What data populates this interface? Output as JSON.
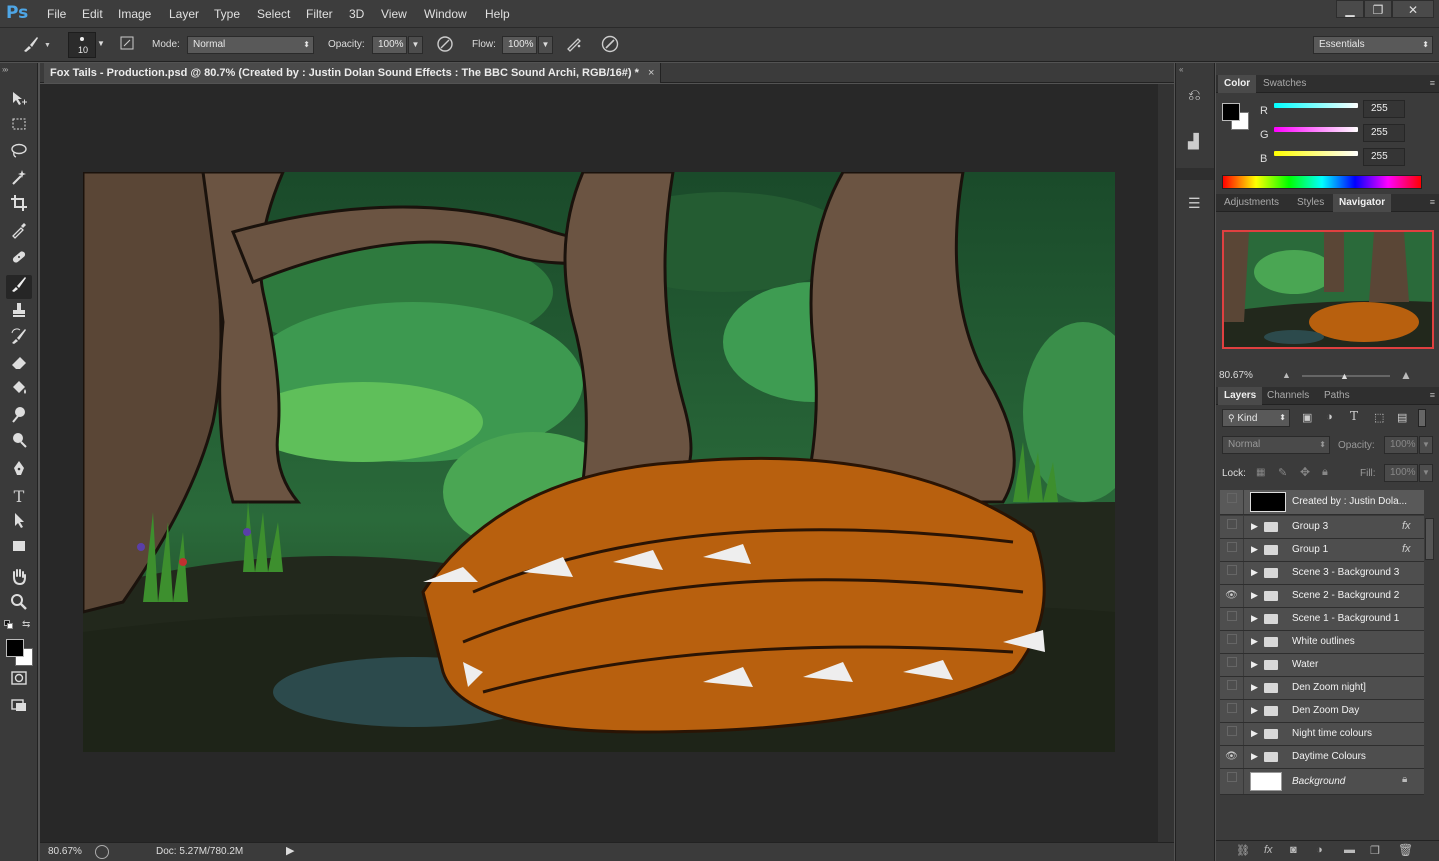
{
  "app": {
    "logo": "Ps"
  },
  "menu": [
    "File",
    "Edit",
    "Image",
    "Layer",
    "Type",
    "Select",
    "Filter",
    "3D",
    "View",
    "Window",
    "Help"
  ],
  "window_controls": {
    "minimize": "▁",
    "restore": "❐",
    "close": "✕"
  },
  "options": {
    "brush_size": "10",
    "mode_label": "Mode:",
    "mode_value": "Normal",
    "opacity_label": "Opacity:",
    "opacity_value": "100%",
    "flow_label": "Flow:",
    "flow_value": "100%",
    "workspace": "Essentials"
  },
  "document": {
    "tab_title": "Fox Tails - Production.psd @ 80.7% (Created by : Justin Dolan   Sound Effects : The BBC Sound Archi, RGB/16#) *",
    "tab_close": "×",
    "zoom": "80.67%",
    "doc_info": "Doc: 5.27M/780.2M"
  },
  "color_panel": {
    "tabs": [
      "Color",
      "Swatches"
    ],
    "channels": [
      {
        "label": "R",
        "value": "255",
        "color": "#00ffff"
      },
      {
        "label": "G",
        "value": "255",
        "color": "#ff00ff"
      },
      {
        "label": "B",
        "value": "255",
        "color": "#ffff00"
      }
    ]
  },
  "nav_panel": {
    "tabs": [
      "Adjustments",
      "Styles",
      "Navigator"
    ],
    "active_tab": "Navigator",
    "zoom": "80.67%"
  },
  "layers_panel": {
    "tabs": [
      "Layers",
      "Channels",
      "Paths"
    ],
    "filter_label": "Kind",
    "blend_mode": "Normal",
    "opacity_label": "Opacity:",
    "opacity_value": "100%",
    "lock_label": "Lock:",
    "fill_label": "Fill:",
    "fill_value": "100%",
    "layers": [
      {
        "name": "Created by : Justin Dola...",
        "type": "text-thumb",
        "visible": false,
        "fx": false
      },
      {
        "name": "Group 3",
        "type": "group",
        "visible": false,
        "fx": true
      },
      {
        "name": "Group 1",
        "type": "group",
        "visible": false,
        "fx": true
      },
      {
        "name": "Scene 3 - Background 3",
        "type": "group",
        "visible": false,
        "fx": false
      },
      {
        "name": "Scene 2 - Background 2",
        "type": "group",
        "visible": true,
        "fx": false
      },
      {
        "name": "Scene 1 - Background 1",
        "type": "group",
        "visible": false,
        "fx": false
      },
      {
        "name": "White outlines",
        "type": "group",
        "visible": false,
        "fx": false
      },
      {
        "name": "Water",
        "type": "group",
        "visible": false,
        "fx": false
      },
      {
        "name": "Den Zoom night]",
        "type": "group",
        "visible": false,
        "fx": false
      },
      {
        "name": "Den Zoom Day",
        "type": "group",
        "visible": false,
        "fx": false
      },
      {
        "name": "Night time colours",
        "type": "group",
        "visible": false,
        "fx": false
      },
      {
        "name": "Daytime Colours",
        "type": "group",
        "visible": true,
        "fx": false
      },
      {
        "name": "Background",
        "type": "background",
        "visible": false,
        "fx": false
      }
    ],
    "fx_label": "fx"
  }
}
